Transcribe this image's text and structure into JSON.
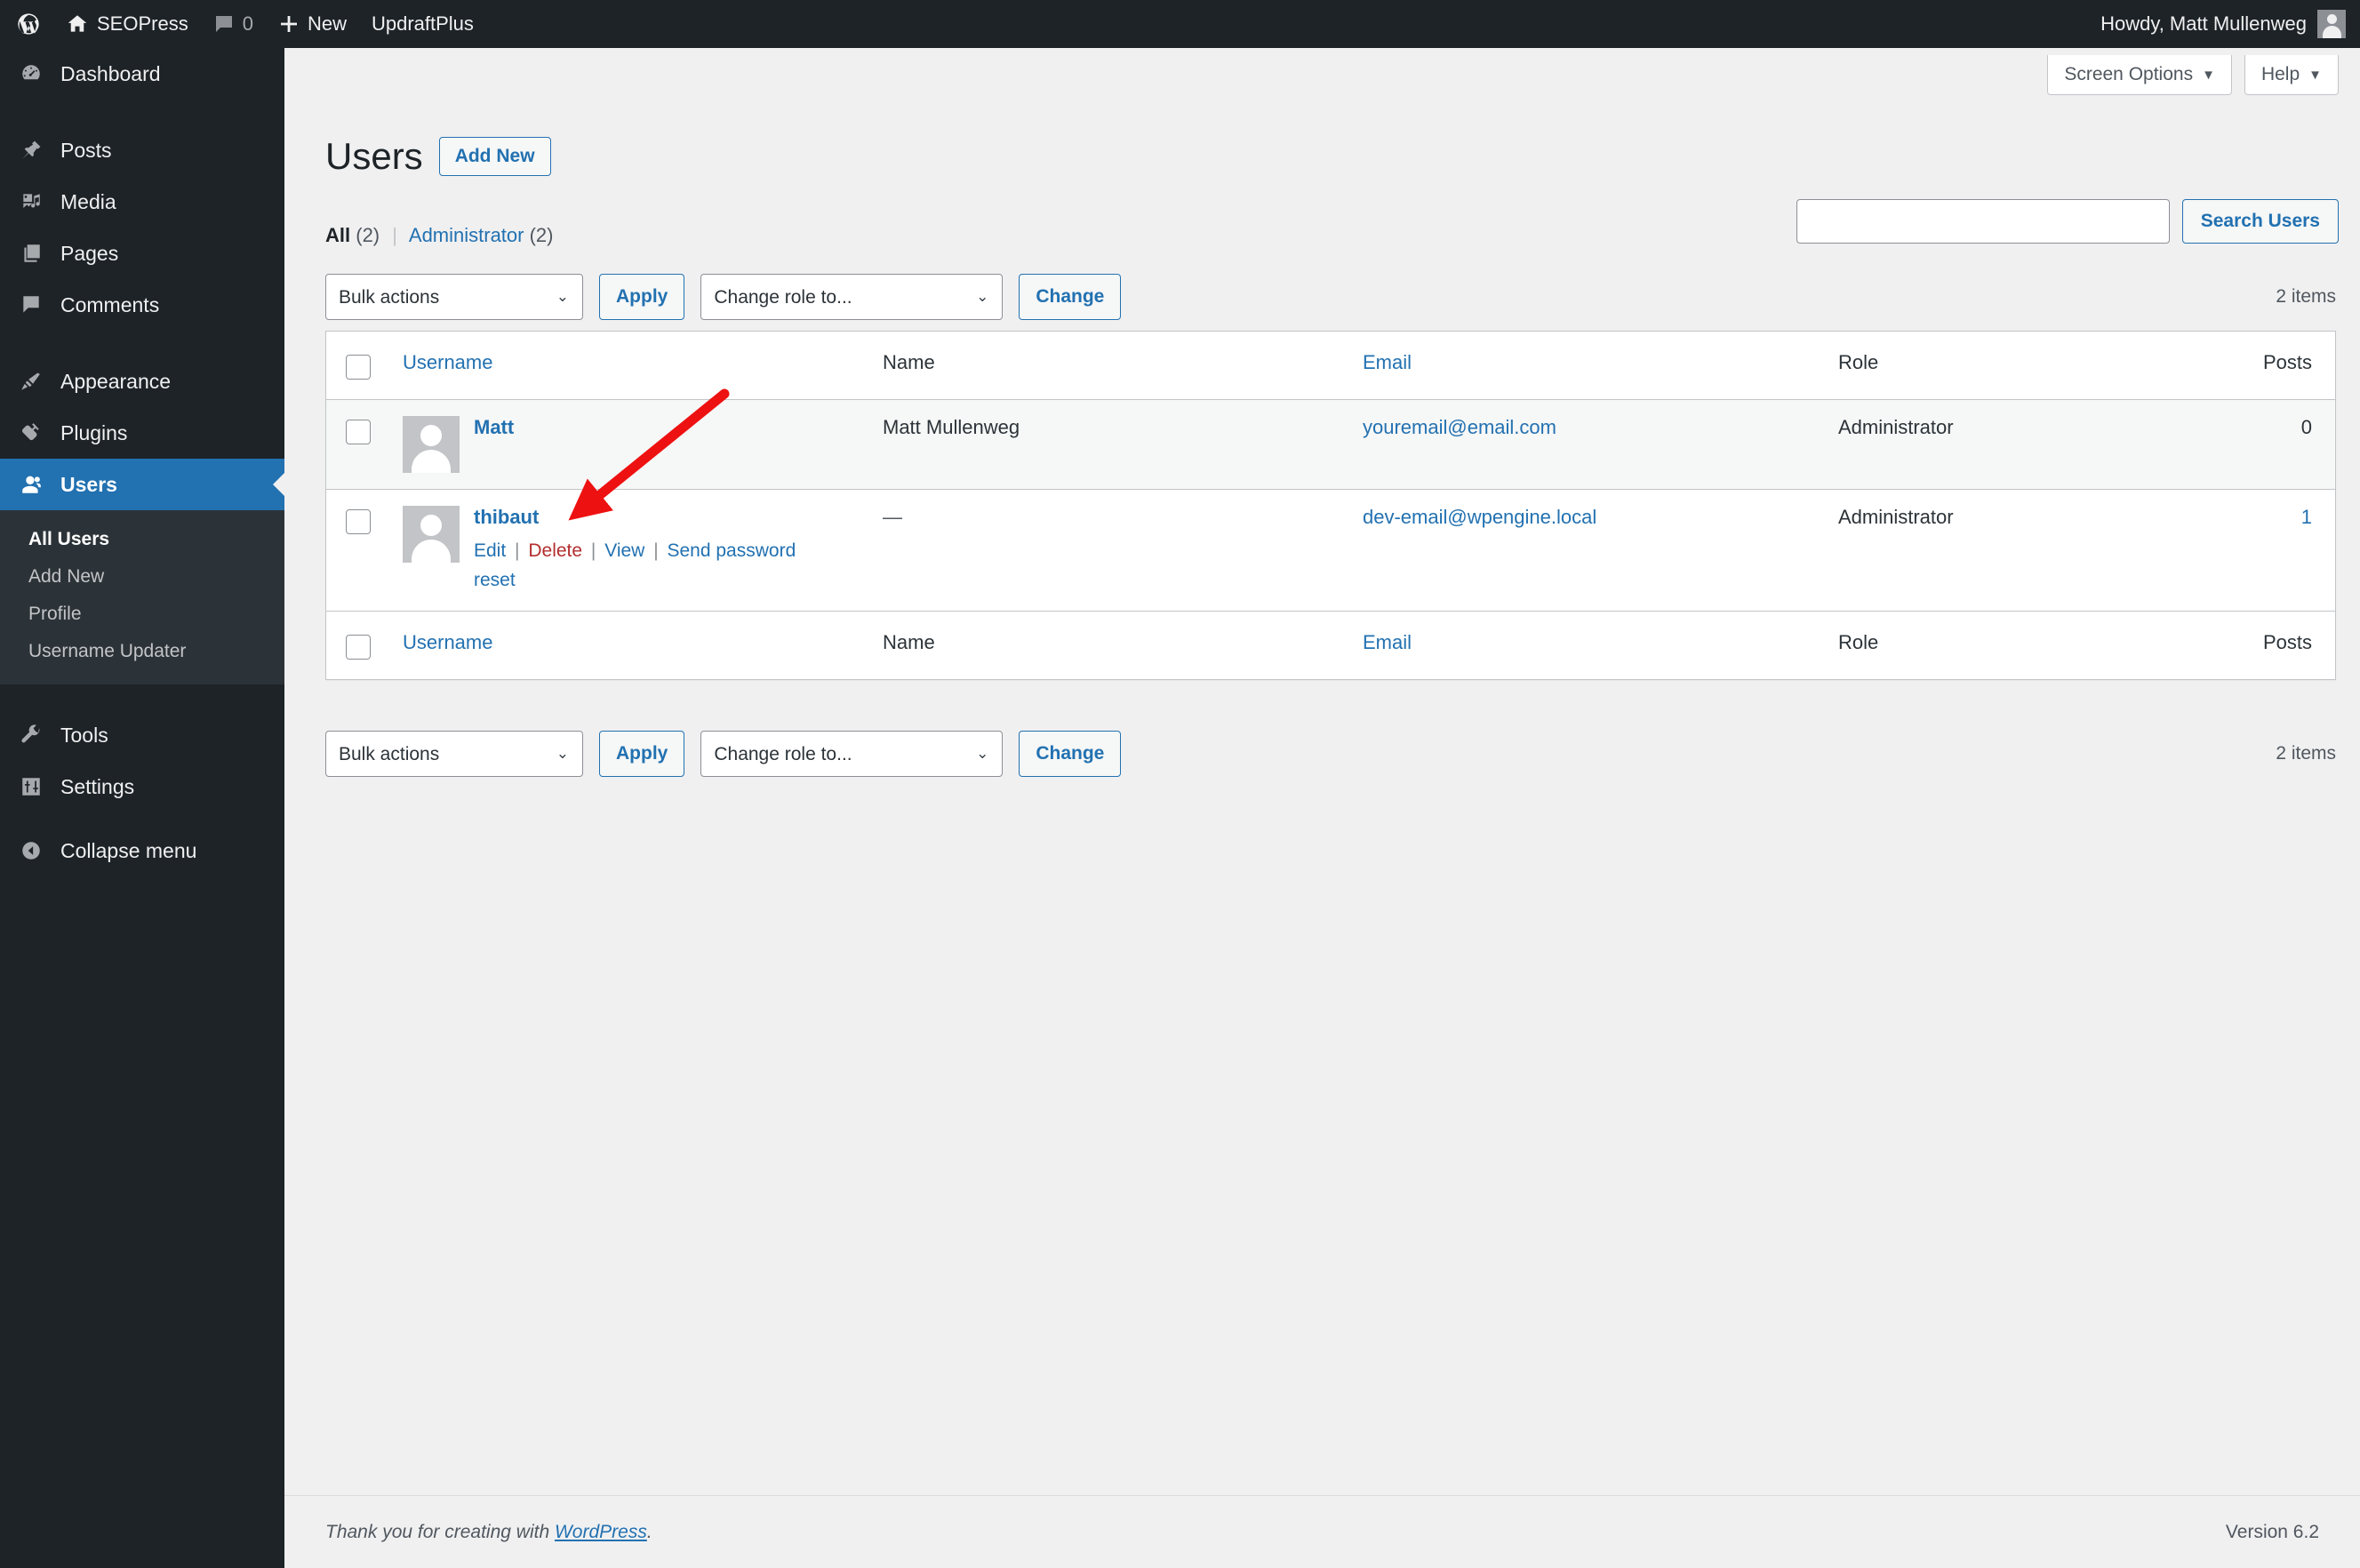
{
  "adminbar": {
    "items": [
      {
        "label": "",
        "icon": "wordpress-logo-icon"
      },
      {
        "label": "SEOPress",
        "icon": "home-icon"
      },
      {
        "label": "0",
        "icon": "comment-bubble-icon"
      },
      {
        "label": "New",
        "icon": "plus-icon"
      },
      {
        "label": "UpdraftPlus",
        "icon": ""
      }
    ],
    "site_name": "SEOPress",
    "comment_count": "0",
    "new_label": "New",
    "updraft_label": "UpdraftPlus",
    "howdy": "Howdy, Matt Mullenweg"
  },
  "sidebar": {
    "items": [
      {
        "label": "Dashboard",
        "icon": "dashboard-icon",
        "current": false
      },
      {
        "label": "Posts",
        "icon": "pin-icon",
        "current": false
      },
      {
        "label": "Media",
        "icon": "media-icon",
        "current": false
      },
      {
        "label": "Pages",
        "icon": "pages-icon",
        "current": false
      },
      {
        "label": "Comments",
        "icon": "comment-bubble-icon",
        "current": false
      },
      {
        "label": "Appearance",
        "icon": "paintbrush-icon",
        "current": false
      },
      {
        "label": "Plugins",
        "icon": "plug-icon",
        "current": false
      },
      {
        "label": "Users",
        "icon": "users-icon",
        "current": true
      },
      {
        "label": "Tools",
        "icon": "wrench-icon",
        "current": false
      },
      {
        "label": "Settings",
        "icon": "settings-sliders-icon",
        "current": false
      }
    ],
    "submenu": [
      {
        "label": "All Users",
        "current": true
      },
      {
        "label": "Add New",
        "current": false
      },
      {
        "label": "Profile",
        "current": false
      },
      {
        "label": "Username Updater",
        "current": false
      }
    ],
    "collapse_label": "Collapse menu"
  },
  "screen_meta": {
    "screen_options": "Screen Options",
    "help": "Help"
  },
  "header": {
    "title": "Users",
    "add_new": "Add New"
  },
  "filters": {
    "all_label": "All",
    "all_count": "(2)",
    "separator": "|",
    "admin_label": "Administrator",
    "admin_count": "(2)"
  },
  "search": {
    "value": "",
    "placeholder": "",
    "button": "Search Users"
  },
  "tablenav": {
    "bulk_actions": "Bulk actions",
    "apply": "Apply",
    "change_role": "Change role to...",
    "change": "Change",
    "items_count": "2 items"
  },
  "table": {
    "columns": {
      "username": "Username",
      "name": "Name",
      "email": "Email",
      "role": "Role",
      "posts": "Posts"
    },
    "rows": [
      {
        "username": "Matt",
        "name": "Matt Mullenweg",
        "email": "youremail@email.com",
        "role": "Administrator",
        "posts": "0",
        "posts_is_link": false,
        "has_actions": false
      },
      {
        "username": "thibaut",
        "name": "—",
        "email": "dev-email@wpengine.local",
        "role": "Administrator",
        "posts": "1",
        "posts_is_link": true,
        "has_actions": true,
        "actions": {
          "edit": "Edit",
          "delete": "Delete",
          "view": "View",
          "send_password_reset": "Send password reset"
        }
      }
    ]
  },
  "annotation": {
    "color": "#ee1111",
    "points_at": "Delete"
  },
  "footer": {
    "thanks_prefix": "Thank you for creating with ",
    "wordpress_link": "WordPress",
    "thanks_suffix": ".",
    "version": "Version 6.2"
  },
  "colors": {
    "accent_blue": "#2271b1",
    "admin_dark": "#1d2327",
    "submenu_bg": "#2c3338",
    "delete_red": "#b32d2e",
    "page_bg": "#f0f0f1"
  }
}
